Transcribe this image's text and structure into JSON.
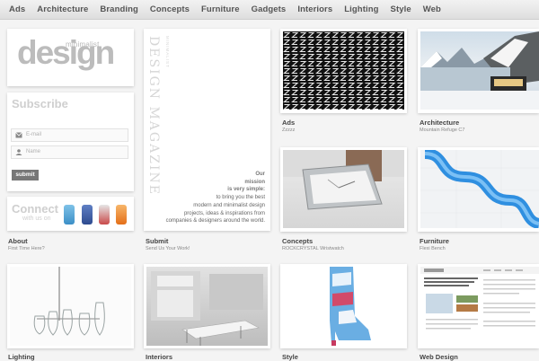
{
  "nav": [
    "Ads",
    "Architecture",
    "Branding",
    "Concepts",
    "Furniture",
    "Gadgets",
    "Interiors",
    "Lighting",
    "Style",
    "Web"
  ],
  "logo": {
    "small": "minimalist",
    "big": "design"
  },
  "subscribe": {
    "title": "Subscribe",
    "email_placeholder": "E-mail",
    "name_placeholder": "Name",
    "submit": "submit"
  },
  "connect": {
    "title": "Connect",
    "sub": "with us on"
  },
  "about": {
    "caption": "About",
    "sub": "First Time Here?"
  },
  "submit_card": {
    "caption": "Submit",
    "sub": "Send Us Your Work!",
    "vertical": "DESIGN MAGAZINE",
    "vertical_small": "MINIMALIST",
    "lines": [
      "Our",
      "mission",
      "is very simple:",
      "to bring you the best",
      "modern and minimalist design",
      "projects, ideas & inspirations from",
      "companies & designers around the world."
    ]
  },
  "tiles": [
    {
      "caption": "Ads",
      "sub": "Zzzzz"
    },
    {
      "caption": "Architecture",
      "sub": "Mountain Refuge C7"
    },
    {
      "caption": "Concepts",
      "sub": "ROCKCRYSTAL Wristwatch"
    },
    {
      "caption": "Furniture",
      "sub": "Flexi Bench"
    },
    {
      "caption": "Lighting",
      "sub": ""
    },
    {
      "caption": "Interiors",
      "sub": ""
    },
    {
      "caption": "Style",
      "sub": ""
    },
    {
      "caption": "Web Design",
      "sub": ""
    }
  ],
  "colors": {
    "accent": "#777777",
    "background": "#f4f4f4"
  }
}
